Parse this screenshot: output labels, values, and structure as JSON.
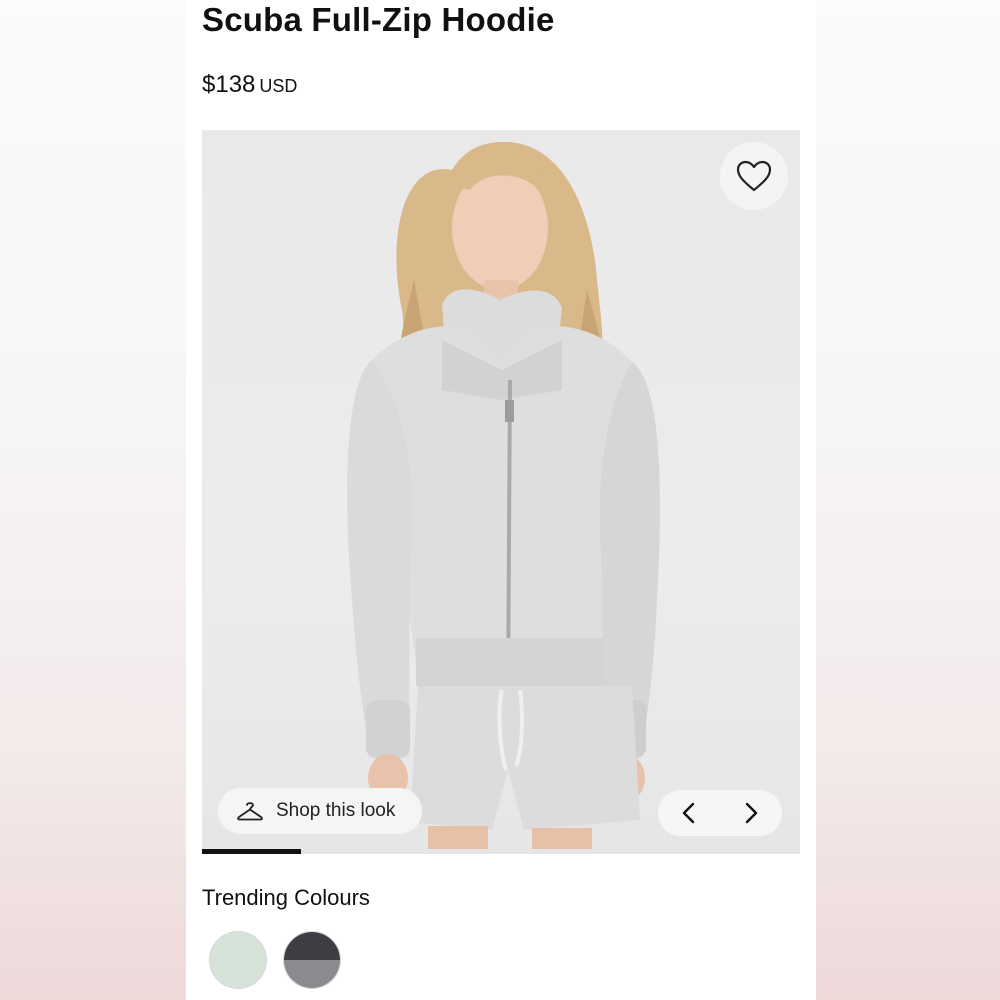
{
  "product": {
    "title": "Scuba Full-Zip Hoodie",
    "price_amount": "$138",
    "price_currency": "USD"
  },
  "gallery": {
    "shop_look_label": "Shop this look",
    "progress_fraction": 0.165,
    "icons": [
      "heart-icon",
      "hanger-icon",
      "chevron-left-icon",
      "chevron-right-icon"
    ]
  },
  "colours": {
    "heading": "Trending Colours",
    "swatches": [
      {
        "name": "swatch-mint",
        "color": "#d5e3d8"
      },
      {
        "name": "swatch-charcoal-grey",
        "color_top": "#3c3e44",
        "color_bottom": "#8a8b8e"
      }
    ]
  }
}
